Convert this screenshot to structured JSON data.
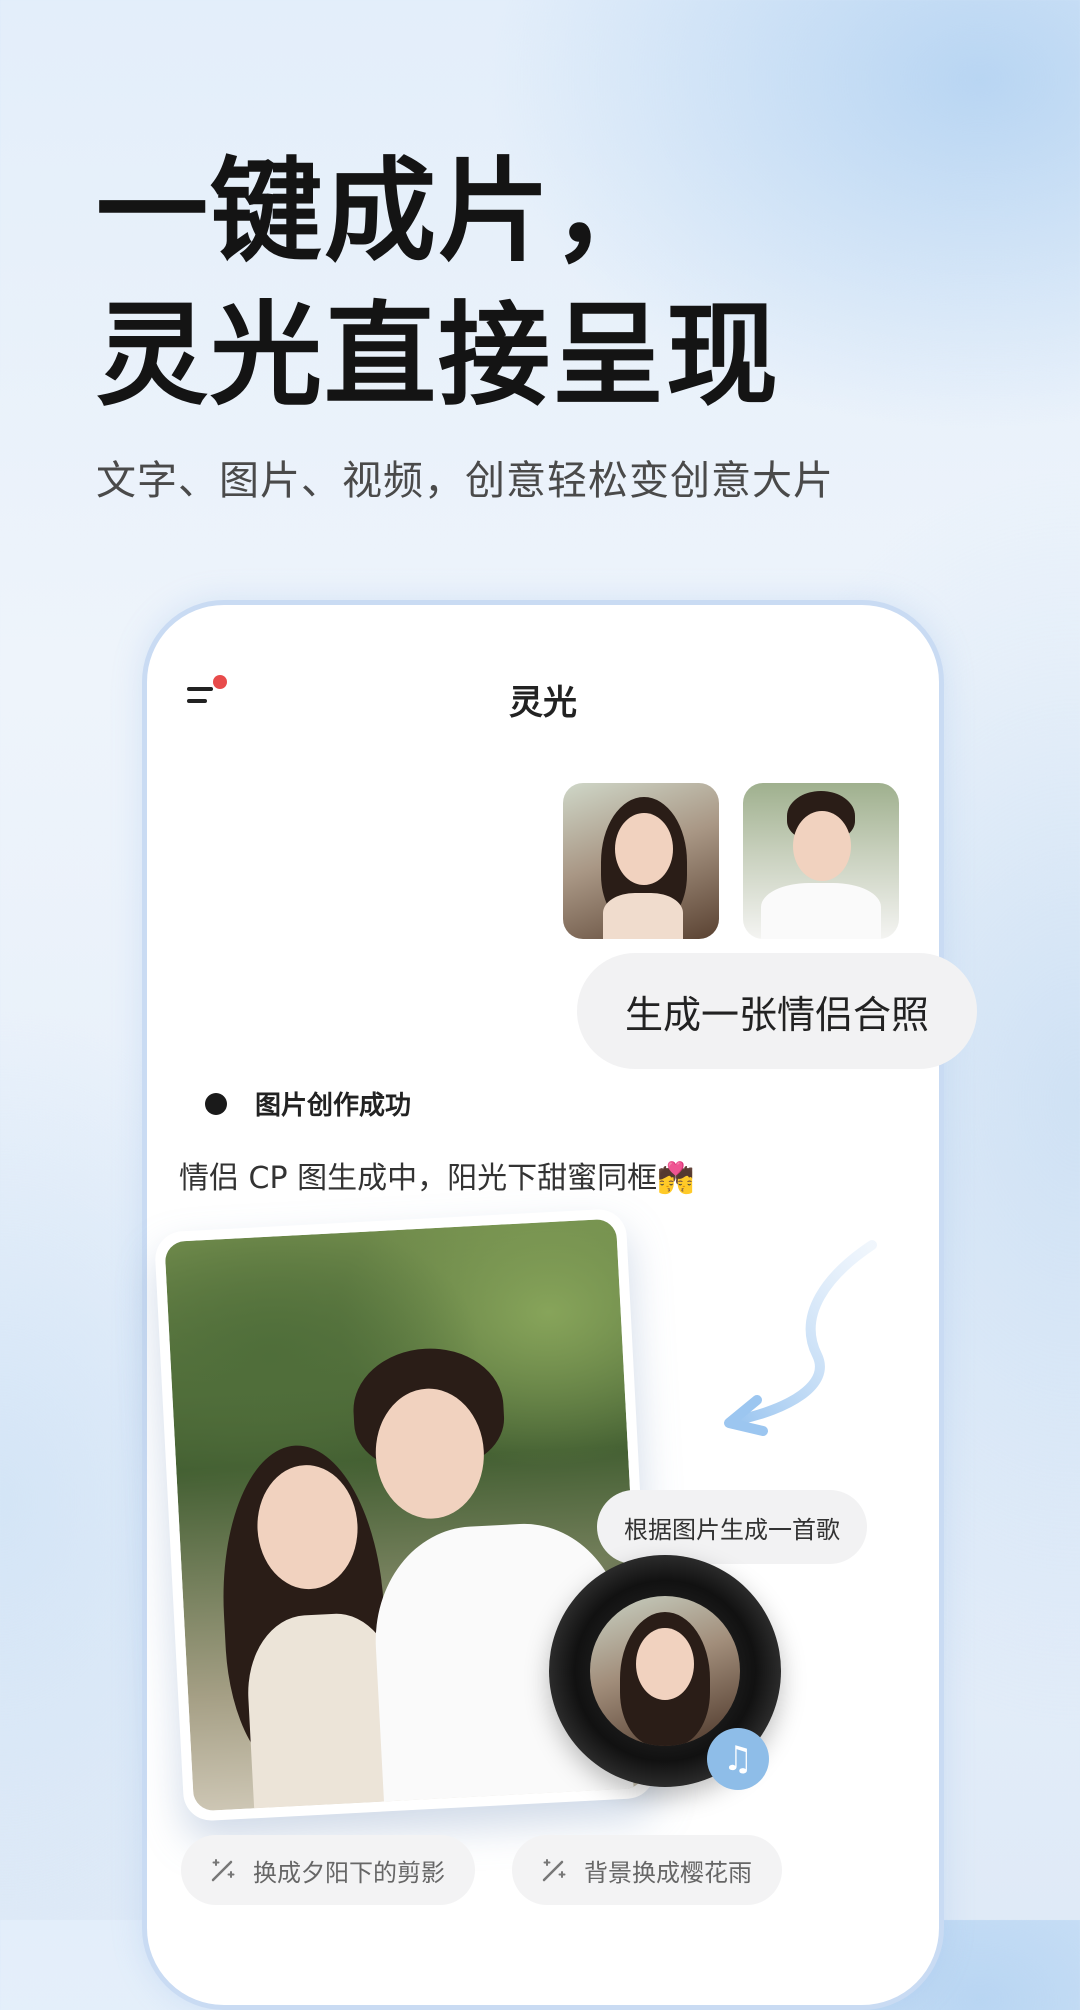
{
  "headline": {
    "line1": "一键成片，",
    "line2": "灵光直接呈现"
  },
  "subtitle": "文字、图片、视频，创意轻松变创意大片",
  "app": {
    "title": "灵光",
    "menu_icon": "menu-with-notification-dot-icon",
    "notification_color": "#e84b4b"
  },
  "chat": {
    "user_images": [
      "woman-portrait",
      "man-portrait"
    ],
    "user_message": "生成一张情侣合照",
    "status_text": "图片创作成功",
    "ai_text": "情侣 CP 图生成中，阳光下甜蜜同框💏",
    "song_suggestion": "根据图片生成一首歌",
    "music_icon": "music-note-icon",
    "suggestion_chips": [
      {
        "icon": "magic-wand-icon",
        "label": "换成夕阳下的剪影"
      },
      {
        "icon": "magic-wand-icon",
        "label": "背景换成樱花雨"
      }
    ]
  },
  "colors": {
    "accent": "#8ebde8",
    "phone_border": "#c9dbf3"
  }
}
